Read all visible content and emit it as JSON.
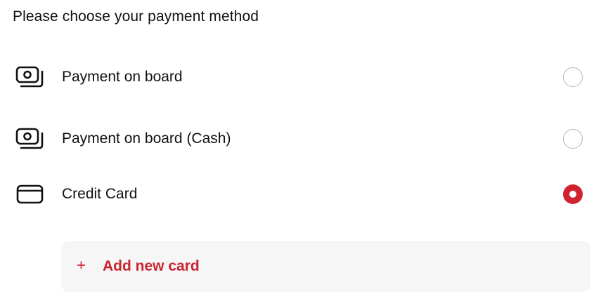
{
  "heading": "Please choose your payment method",
  "options": [
    {
      "label": "Payment on board",
      "icon": "cash-icon",
      "selected": false
    },
    {
      "label": "Payment on board (Cash)",
      "icon": "cash-icon",
      "selected": false
    },
    {
      "label": "Credit Card",
      "icon": "credit-card-icon",
      "selected": true
    }
  ],
  "add_card": {
    "plus": "+",
    "label": "Add new card"
  },
  "colors": {
    "accent": "#d0232f",
    "panel": "#f6f6f6",
    "radio_border": "#b5b5b5"
  }
}
